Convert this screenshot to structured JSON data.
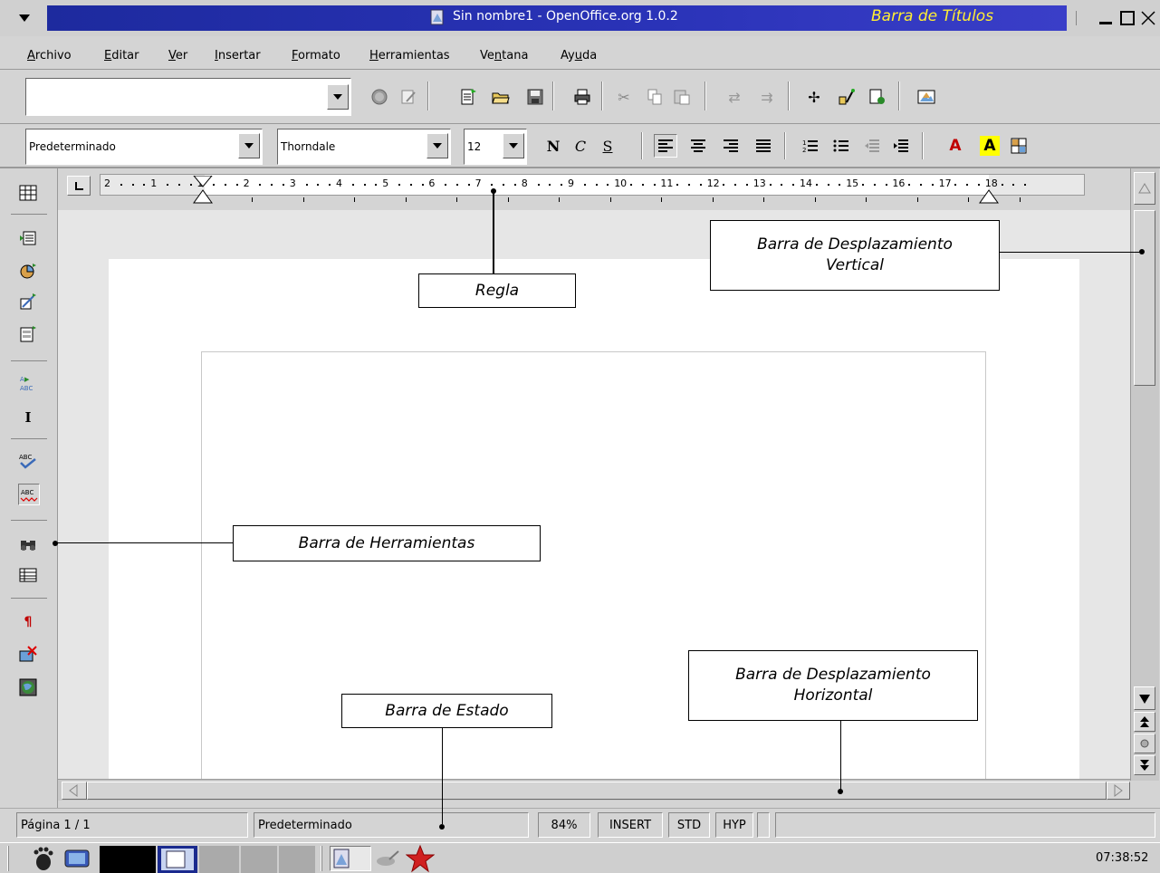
{
  "window": {
    "title": "Sin nombre1 - OpenOffice.org 1.0.2",
    "title_annotation": "Barra de Títulos"
  },
  "menu": {
    "items": [
      {
        "label": "Archivo"
      },
      {
        "label": "Editar"
      },
      {
        "label": "Ver"
      },
      {
        "label": "Insertar"
      },
      {
        "label": "Formato"
      },
      {
        "label": "Herramientas"
      },
      {
        "label": "Ventana"
      },
      {
        "label": "Ayuda"
      }
    ]
  },
  "toolbar": {
    "url_value": ""
  },
  "format_bar": {
    "style": "Predeterminado",
    "font": "Thorndale",
    "size": "12",
    "bold_label": "N",
    "italic_label": "C",
    "underline_label": "S",
    "font_color_label": "A",
    "highlight_label": "A"
  },
  "ruler": {
    "labels": [
      "2",
      "1",
      "1",
      "2",
      "3",
      "4",
      "5",
      "6",
      "7",
      "8",
      "9",
      "10",
      "11",
      "12",
      "13",
      "14",
      "15",
      "16",
      "17",
      "18"
    ]
  },
  "status": {
    "page": "Página  1 / 1",
    "style": "Predeterminado",
    "zoom": "84%",
    "mode": "INSERT",
    "selection": "STD",
    "hyperlink": "HYP"
  },
  "taskbar": {
    "clock": "07:38:52"
  },
  "callouts": {
    "ruler": "Regla",
    "vertical_scroll": "Barra de Desplazamiento Vertical",
    "toolbar": "Barra de Herramientas",
    "status_bar": "Barra de Estado",
    "horizontal_scroll": "Barra de Desplazamiento Horizontal"
  },
  "colors": {
    "title_bar": "#1d2a9e",
    "title_annotation": "#ffee33",
    "font_color": "#c00000",
    "highlight": "#ffff00"
  },
  "icons": [
    "window-menu-icon",
    "minimize-icon",
    "maximize-icon",
    "close-icon",
    "stop-icon",
    "edit-file-icon",
    "new-icon",
    "open-icon",
    "save-icon",
    "print-icon",
    "cut-icon",
    "copy-icon",
    "paste-icon",
    "undo-icon",
    "redo-icon",
    "navigator-icon",
    "stylist-icon",
    "data-sources-icon",
    "gallery-icon",
    "numbering-icon",
    "bullets-icon",
    "decrease-indent-icon",
    "increase-indent-icon",
    "insert-table-icon",
    "insert-field-icon",
    "insert-object-icon",
    "insert-form-icon",
    "auto-text-icon",
    "text-cursor-icon",
    "spellcheck-icon",
    "autospellcheck-icon",
    "find-icon",
    "data-grid-icon",
    "formatting-marks-icon",
    "graphics-off-icon",
    "online-layout-icon"
  ]
}
